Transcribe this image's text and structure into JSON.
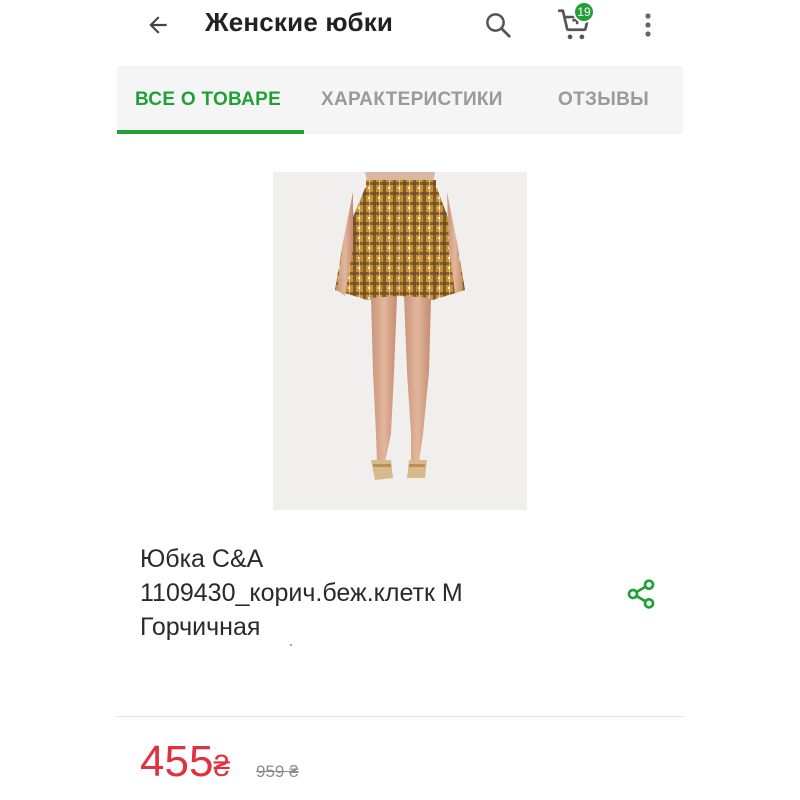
{
  "header": {
    "title": "Женские юбки",
    "cart_count": "19",
    "icons": [
      "back-arrow-icon",
      "search-icon",
      "cart-icon",
      "more-vertical-icon"
    ]
  },
  "tabs": [
    {
      "label": "ВСЕ О ТОВАРЕ",
      "active": true
    },
    {
      "label": "ХАРАКТЕРИСТИКИ",
      "active": false
    },
    {
      "label": "ОТЗЫВЫ",
      "active": false
    }
  ],
  "product": {
    "name_lines": [
      "Юбка C&A",
      "1109430_корич.беж.клетк M",
      "Горчичная"
    ],
    "price": {
      "current": "455",
      "current_currency": "₴",
      "old": "959 ₴"
    }
  },
  "colors": {
    "accent": "#21a038",
    "price": "#e0323e"
  }
}
